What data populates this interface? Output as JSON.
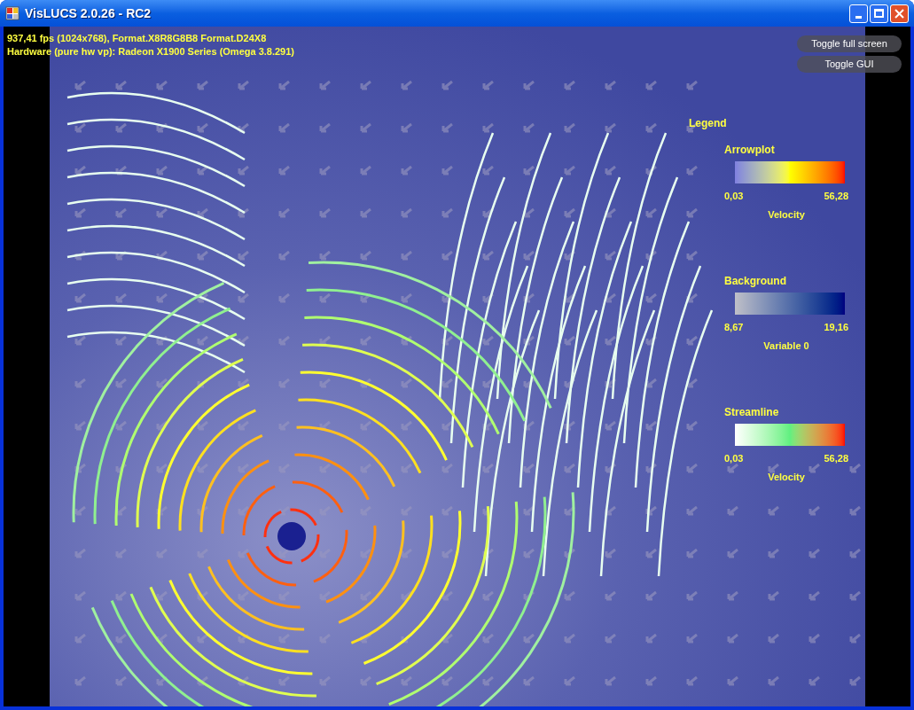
{
  "window": {
    "title": "VisLUCS 2.0.26 - RC2"
  },
  "stats": [
    "937,41 fps (1024x768), Format.X8R8G8B8 Format.D24X8",
    "Hardware (pure hw vp): Radeon X1900 Series (Omega 3.8.291)"
  ],
  "buttons": [
    "Toggle full screen",
    "Toggle GUI"
  ],
  "legend": {
    "title": "Legend",
    "items": [
      {
        "name": "Arrowplot",
        "kind": "heat",
        "min": "0,03",
        "max": "56,28",
        "variable": "Velocity"
      },
      {
        "name": "Background",
        "kind": "grayblue",
        "min": "8,67",
        "max": "19,16",
        "variable": "Variable 0"
      },
      {
        "name": "Streamline",
        "kind": "stream",
        "min": "0,03",
        "max": "56,28",
        "variable": "Velocity"
      }
    ]
  }
}
